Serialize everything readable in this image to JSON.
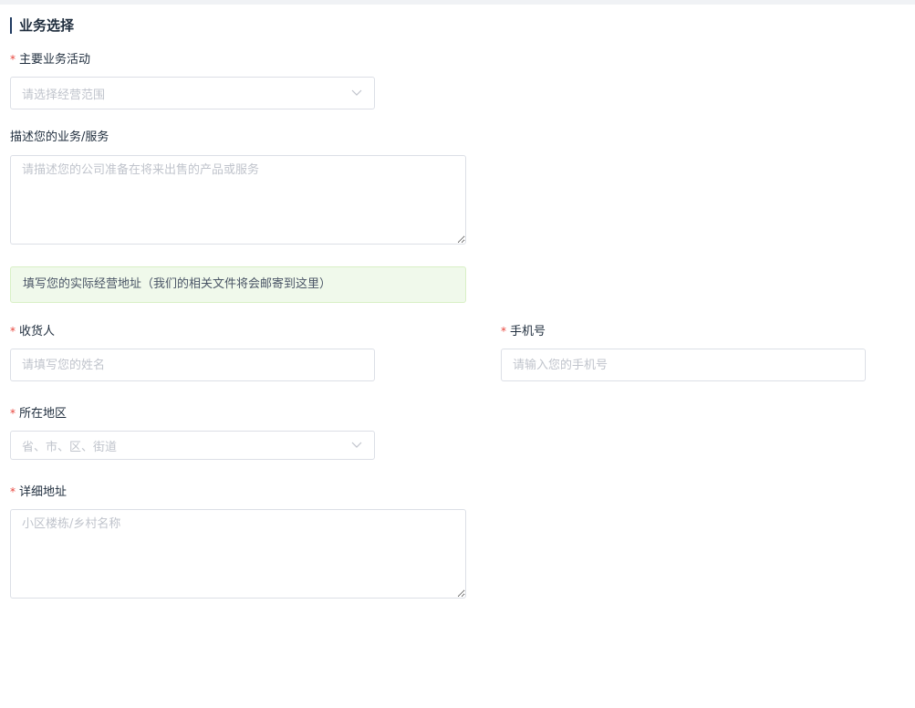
{
  "section": {
    "title": "业务选择"
  },
  "required_marker": "*",
  "business": {
    "label": "主要业务活动",
    "placeholder": "请选择经营范围"
  },
  "description": {
    "label": "描述您的业务/服务",
    "placeholder": "请描述您的公司准备在将来出售的产品或服务"
  },
  "notice": {
    "text": "填写您的实际经营地址（我们的相关文件将会邮寄到这里）"
  },
  "receiver": {
    "label": "收货人",
    "placeholder": "请填写您的姓名"
  },
  "phone": {
    "label": "手机号",
    "placeholder": "请输入您的手机号"
  },
  "region": {
    "label": "所在地区",
    "placeholder": "省、市、区、街道"
  },
  "address": {
    "label": "详细地址",
    "placeholder": "小区楼栋/乡村名称"
  },
  "icons": {
    "select_arrow": "chevron-down-icon"
  },
  "colors": {
    "required": "#e8453c",
    "title_bar": "#1f3a60",
    "notice_bg": "#f0f9eb",
    "border": "#dcdfe6",
    "placeholder": "#c0c4cc"
  }
}
